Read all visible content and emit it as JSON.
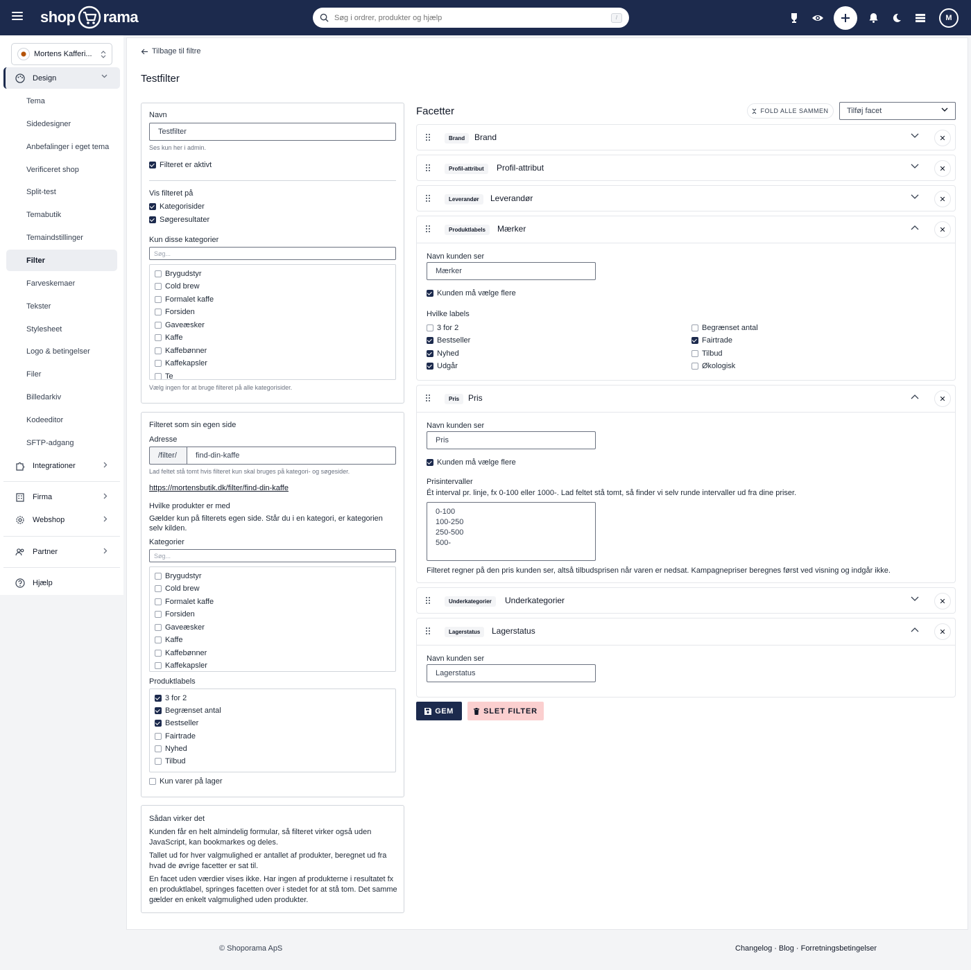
{
  "topbar": {
    "logo_left": "shop",
    "logo_right": "rama",
    "search_placeholder": "Søg i ordrer, produkter og hjælp",
    "search_shortcut": "/",
    "avatar_initial": "M",
    "icons": [
      "menu-icon",
      "search-icon",
      "award-icon",
      "eye-icon",
      "plus-icon",
      "bell-icon",
      "moon-icon",
      "layout-icon"
    ]
  },
  "sidebar": {
    "shop_name": "Mortens Kafferi...",
    "design": "Design",
    "items": [
      "Tema",
      "Sidedesigner",
      "Anbefalinger i eget tema",
      "Verificeret shop",
      "Split-test",
      "Temabutik",
      "Temaindstillinger",
      "Filter",
      "Farveskemaer",
      "Tekster",
      "Stylesheet",
      "Logo & betingelser",
      "Filer",
      "Billedarkiv",
      "Kodeeditor",
      "SFTP-adgang"
    ],
    "active_item": "Filter",
    "integrations": "Integrationer",
    "company": "Firma",
    "webshop": "Webshop",
    "partner": "Partner",
    "help": "Hjælp"
  },
  "main": {
    "back": "Tilbage til filtre",
    "title": "Testfilter"
  },
  "form": {
    "name_label": "Navn",
    "name_value": "Testfilter",
    "name_hint": "Ses kun her i admin.",
    "active_label": "Filteret er aktivt",
    "active": true,
    "show_on_label": "Vis filteret på",
    "show_on": [
      {
        "label": "Kategorisider",
        "checked": true
      },
      {
        "label": "Søgeresultater",
        "checked": true
      }
    ],
    "only_categories_label": "Kun disse kategorier",
    "search_placeholder": "Søg...",
    "categories": [
      "Brygudstyr",
      "Cold brew",
      "Formalet kaffe",
      "Forsiden",
      "Gaveæsker",
      "Kaffe",
      "Kaffebønner",
      "Kaffekapsler",
      "Te"
    ],
    "categories_hint": "Vælg ingen for at bruge filteret på alle kategorisider."
  },
  "own_page": {
    "title": "Filteret som sin egen side",
    "address_label": "Adresse",
    "address_prefix": "/filter/",
    "address_value": "find-din-kaffe",
    "address_hint": "Lad feltet stå tomt hvis filteret kun skal bruges på kategori- og søgesider.",
    "url": "https://mortensbutik.dk/filter/find-din-kaffe",
    "products_label": "Hvilke produkter er med",
    "products_desc": "Gælder kun på filterets egen side. Står du i en kategori, er kategorien selv kilden.",
    "categories_label": "Kategorier",
    "search_placeholder": "Søg...",
    "categories": [
      "Brygudstyr",
      "Cold brew",
      "Formalet kaffe",
      "Forsiden",
      "Gaveæsker",
      "Kaffe",
      "Kaffebønner",
      "Kaffekapsler"
    ],
    "labels_label": "Produktlabels",
    "labels": [
      {
        "label": "3 for 2",
        "checked": true
      },
      {
        "label": "Begrænset antal",
        "checked": true
      },
      {
        "label": "Bestseller",
        "checked": true
      },
      {
        "label": "Fairtrade",
        "checked": false
      },
      {
        "label": "Nyhed",
        "checked": false
      },
      {
        "label": "Tilbud",
        "checked": false
      }
    ],
    "in_stock_label": "Kun varer på lager",
    "in_stock": false
  },
  "how": {
    "title": "Sådan virker det",
    "p1": "Kunden får en helt almindelig formular, så filteret virker også uden JavaScript, kan bookmarkes og deles.",
    "p2": "Tallet ud for hver valgmulighed er antallet af produkter, beregnet ud fra hvad de øvrige facetter er sat til.",
    "p3": "En facet uden værdier vises ikke. Har ingen af produkterne i resultatet fx en produktlabel, springes facetten over i stedet for at stå tom. Det samme gælder en enkelt valgmulighed uden produkter."
  },
  "facets": {
    "title": "Facetter",
    "fold_all": "FOLD ALLE SAMMEN",
    "add_facet": "Tilføj facet",
    "list": [
      {
        "tag": "Brand",
        "name": "Brand",
        "expanded": false
      },
      {
        "tag": "Profil-attribut",
        "name": "Profil-attribut",
        "expanded": false
      },
      {
        "tag": "Leverandør",
        "name": "Leverandør",
        "expanded": false
      },
      {
        "tag": "Produktlabels",
        "name": "Mærker",
        "expanded": true
      },
      {
        "tag": "Pris",
        "name": "Pris",
        "expanded": true
      },
      {
        "tag": "Underkategorier",
        "name": "Underkategorier",
        "expanded": false
      },
      {
        "tag": "Lagerstatus",
        "name": "Lagerstatus",
        "expanded": true
      }
    ],
    "labels_facet": {
      "customer_name_label": "Navn kunden ser",
      "customer_name": "Mærker",
      "multi_label": "Kunden må vælge flere",
      "multi": true,
      "which_labels": "Hvilke labels",
      "labels": [
        {
          "label": "3 for 2",
          "checked": false
        },
        {
          "label": "Begrænset antal",
          "checked": false
        },
        {
          "label": "Bestseller",
          "checked": true
        },
        {
          "label": "Fairtrade",
          "checked": true
        },
        {
          "label": "Nyhed",
          "checked": true
        },
        {
          "label": "Tilbud",
          "checked": false
        },
        {
          "label": "Udgår",
          "checked": true
        },
        {
          "label": "Økologisk",
          "checked": false
        }
      ]
    },
    "price_facet": {
      "customer_name_label": "Navn kunden ser",
      "customer_name": "Pris",
      "multi_label": "Kunden må vælge flere",
      "multi": true,
      "intervals_label": "Prisintervaller",
      "intervals_hint": "Ét interval pr. linje, fx 0-100 eller 1000-. Lad feltet stå tomt, så finder vi selv runde intervaller ud fra dine priser.",
      "intervals": "0-100\n100-250\n250-500\n500-",
      "footer": "Filteret regner på den pris kunden ser, altså tilbudsprisen når varen er nedsat. Kampagnepriser beregnes først ved visning og indgår ikke."
    },
    "stock_facet": {
      "customer_name_label": "Navn kunden ser",
      "customer_name": "Lagerstatus"
    }
  },
  "actions": {
    "save": "GEM",
    "delete": "SLET FILTER"
  },
  "footer": {
    "copyright": "© Shoporama ApS",
    "links": [
      "Changelog",
      "Blog",
      "Forretningsbetingelser"
    ]
  }
}
